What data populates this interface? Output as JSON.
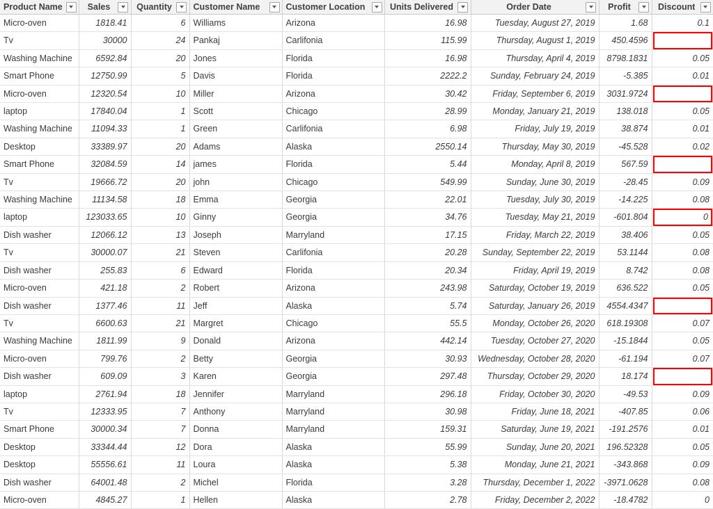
{
  "table": {
    "columns": [
      {
        "key": "product_name",
        "label": "Product Name",
        "align": "left",
        "header_align": "left",
        "filter": true
      },
      {
        "key": "sales",
        "label": "Sales",
        "align": "right",
        "header_align": "center",
        "filter": true
      },
      {
        "key": "quantity",
        "label": "Quantity",
        "align": "right",
        "header_align": "center",
        "filter": true
      },
      {
        "key": "customer_name",
        "label": "Customer Name",
        "align": "left",
        "header_align": "left",
        "filter": true
      },
      {
        "key": "customer_location",
        "label": "Customer Location",
        "align": "left",
        "header_align": "left",
        "filter": true
      },
      {
        "key": "units_delivered",
        "label": "Units Delivered",
        "align": "right",
        "header_align": "center",
        "filter": true
      },
      {
        "key": "order_date",
        "label": "Order Date",
        "align": "right",
        "header_align": "center",
        "filter": true
      },
      {
        "key": "profit",
        "label": "Profit",
        "align": "right",
        "header_align": "center",
        "filter": true
      },
      {
        "key": "discount",
        "label": "Discount",
        "align": "right",
        "header_align": "center",
        "filter": true
      }
    ],
    "filter_icon": "filter-dropdown-icon",
    "highlight_color": "#ff0000",
    "header_background": "#f2f2f2",
    "rows": [
      {
        "product_name": "Micro-oven",
        "sales": "1818.41",
        "quantity": "6",
        "customer_name": "Williams",
        "customer_location": "Arizona",
        "units_delivered": "16.98",
        "order_date": "Tuesday, August 27, 2019",
        "profit": "1.68",
        "discount": "0.1",
        "discount_highlighted": false
      },
      {
        "product_name": "Tv",
        "sales": "30000",
        "quantity": "24",
        "customer_name": "Pankaj",
        "customer_location": "Carlifonia",
        "units_delivered": "115.99",
        "order_date": "Thursday, August 1, 2019",
        "profit": "450.4596",
        "discount": "",
        "discount_highlighted": true
      },
      {
        "product_name": "Washing Machine",
        "sales": "6592.84",
        "quantity": "20",
        "customer_name": "Jones",
        "customer_location": "Florida",
        "units_delivered": "16.98",
        "order_date": "Thursday, April 4, 2019",
        "profit": "8798.1831",
        "discount": "0.05",
        "discount_highlighted": false
      },
      {
        "product_name": "Smart Phone",
        "sales": "12750.99",
        "quantity": "5",
        "customer_name": "Davis",
        "customer_location": "Florida",
        "units_delivered": "2222.2",
        "order_date": "Sunday, February 24, 2019",
        "profit": "-5.385",
        "discount": "0.01",
        "discount_highlighted": false
      },
      {
        "product_name": "Micro-oven",
        "sales": "12320.54",
        "quantity": "10",
        "customer_name": "Miller",
        "customer_location": "Arizona",
        "units_delivered": "30.42",
        "order_date": "Friday, September 6, 2019",
        "profit": "3031.9724",
        "discount": "",
        "discount_highlighted": true
      },
      {
        "product_name": "laptop",
        "sales": "17840.04",
        "quantity": "1",
        "customer_name": "Scott",
        "customer_location": "Chicago",
        "units_delivered": "28.99",
        "order_date": "Monday, January 21, 2019",
        "profit": "138.018",
        "discount": "0.05",
        "discount_highlighted": false
      },
      {
        "product_name": "Washing Machine",
        "sales": "11094.33",
        "quantity": "1",
        "customer_name": "Green",
        "customer_location": "Carlifonia",
        "units_delivered": "6.98",
        "order_date": "Friday, July 19, 2019",
        "profit": "38.874",
        "discount": "0.01",
        "discount_highlighted": false
      },
      {
        "product_name": "Desktop",
        "sales": "33389.97",
        "quantity": "20",
        "customer_name": "Adams",
        "customer_location": "Alaska",
        "units_delivered": "2550.14",
        "order_date": "Thursday, May 30, 2019",
        "profit": "-45.528",
        "discount": "0.02",
        "discount_highlighted": false
      },
      {
        "product_name": "Smart Phone",
        "sales": "32084.59",
        "quantity": "14",
        "customer_name": "james",
        "customer_location": "Florida",
        "units_delivered": "5.44",
        "order_date": "Monday, April 8, 2019",
        "profit": "567.59",
        "discount": "",
        "discount_highlighted": true
      },
      {
        "product_name": "Tv",
        "sales": "19666.72",
        "quantity": "20",
        "customer_name": "john",
        "customer_location": "Chicago",
        "units_delivered": "549.99",
        "order_date": "Sunday, June 30, 2019",
        "profit": "-28.45",
        "discount": "0.09",
        "discount_highlighted": false
      },
      {
        "product_name": "Washing Machine",
        "sales": "11134.58",
        "quantity": "18",
        "customer_name": "Emma",
        "customer_location": "Georgia",
        "units_delivered": "22.01",
        "order_date": "Tuesday, July 30, 2019",
        "profit": "-14.225",
        "discount": "0.08",
        "discount_highlighted": false
      },
      {
        "product_name": "laptop",
        "sales": "123033.65",
        "quantity": "10",
        "customer_name": "Ginny",
        "customer_location": "Georgia",
        "units_delivered": "34.76",
        "order_date": "Tuesday, May 21, 2019",
        "profit": "-601.804",
        "discount": "0",
        "discount_highlighted": true
      },
      {
        "product_name": "Dish washer",
        "sales": "12066.12",
        "quantity": "13",
        "customer_name": "Joseph",
        "customer_location": "Marryland",
        "units_delivered": "17.15",
        "order_date": "Friday, March 22, 2019",
        "profit": "38.406",
        "discount": "0.05",
        "discount_highlighted": false
      },
      {
        "product_name": "Tv",
        "sales": "30000.07",
        "quantity": "21",
        "customer_name": "Steven",
        "customer_location": "Carlifonia",
        "units_delivered": "20.28",
        "order_date": "Sunday, September 22, 2019",
        "profit": "53.1144",
        "discount": "0.08",
        "discount_highlighted": false
      },
      {
        "product_name": "Dish washer",
        "sales": "255.83",
        "quantity": "6",
        "customer_name": "Edward",
        "customer_location": "Florida",
        "units_delivered": "20.34",
        "order_date": "Friday, April 19, 2019",
        "profit": "8.742",
        "discount": "0.08",
        "discount_highlighted": false
      },
      {
        "product_name": "Micro-oven",
        "sales": "421.18",
        "quantity": "2",
        "customer_name": "Robert",
        "customer_location": "Arizona",
        "units_delivered": "243.98",
        "order_date": "Saturday, October 19, 2019",
        "profit": "636.522",
        "discount": "0.05",
        "discount_highlighted": false
      },
      {
        "product_name": "Dish washer",
        "sales": "1377.46",
        "quantity": "11",
        "customer_name": "Jeff",
        "customer_location": "Alaska",
        "units_delivered": "5.74",
        "order_date": "Saturday, January 26, 2019",
        "profit": "4554.4347",
        "discount": "",
        "discount_highlighted": true
      },
      {
        "product_name": "Tv",
        "sales": "6600.63",
        "quantity": "21",
        "customer_name": "Margret",
        "customer_location": "Chicago",
        "units_delivered": "55.5",
        "order_date": "Monday, October 26, 2020",
        "profit": "618.19308",
        "discount": "0.07",
        "discount_highlighted": false
      },
      {
        "product_name": "Washing Machine",
        "sales": "1811.99",
        "quantity": "9",
        "customer_name": "Donald",
        "customer_location": "Arizona",
        "units_delivered": "442.14",
        "order_date": "Tuesday, October 27, 2020",
        "profit": "-15.1844",
        "discount": "0.05",
        "discount_highlighted": false
      },
      {
        "product_name": "Micro-oven",
        "sales": "799.76",
        "quantity": "2",
        "customer_name": "Betty",
        "customer_location": "Georgia",
        "units_delivered": "30.93",
        "order_date": "Wednesday, October 28, 2020",
        "profit": "-61.194",
        "discount": "0.07",
        "discount_highlighted": false
      },
      {
        "product_name": "Dish washer",
        "sales": "609.09",
        "quantity": "3",
        "customer_name": "Karen",
        "customer_location": "Georgia",
        "units_delivered": "297.48",
        "order_date": "Thursday, October 29, 2020",
        "profit": "18.174",
        "discount": "",
        "discount_highlighted": true
      },
      {
        "product_name": "laptop",
        "sales": "2761.94",
        "quantity": "18",
        "customer_name": "Jennifer",
        "customer_location": "Marryland",
        "units_delivered": "296.18",
        "order_date": "Friday, October 30, 2020",
        "profit": "-49.53",
        "discount": "0.09",
        "discount_highlighted": false
      },
      {
        "product_name": "Tv",
        "sales": "12333.95",
        "quantity": "7",
        "customer_name": "Anthony",
        "customer_location": "Marryland",
        "units_delivered": "30.98",
        "order_date": "Friday, June 18, 2021",
        "profit": "-407.85",
        "discount": "0.06",
        "discount_highlighted": false
      },
      {
        "product_name": "Smart Phone",
        "sales": "30000.34",
        "quantity": "7",
        "customer_name": "Donna",
        "customer_location": "Marryland",
        "units_delivered": "159.31",
        "order_date": "Saturday, June 19, 2021",
        "profit": "-191.2576",
        "discount": "0.01",
        "discount_highlighted": false
      },
      {
        "product_name": "Desktop",
        "sales": "33344.44",
        "quantity": "12",
        "customer_name": "Dora",
        "customer_location": "Alaska",
        "units_delivered": "55.99",
        "order_date": "Sunday, June 20, 2021",
        "profit": "196.52328",
        "discount": "0.05",
        "discount_highlighted": false
      },
      {
        "product_name": "Desktop",
        "sales": "55556.61",
        "quantity": "11",
        "customer_name": "Loura",
        "customer_location": "Alaska",
        "units_delivered": "5.38",
        "order_date": "Monday, June 21, 2021",
        "profit": "-343.868",
        "discount": "0.09",
        "discount_highlighted": false
      },
      {
        "product_name": "Dish washer",
        "sales": "64001.48",
        "quantity": "2",
        "customer_name": "Michel",
        "customer_location": "Florida",
        "units_delivered": "3.28",
        "order_date": "Thursday, December 1, 2022",
        "profit": "-3971.0628",
        "discount": "0.08",
        "discount_highlighted": false
      },
      {
        "product_name": "Micro-oven",
        "sales": "4845.27",
        "quantity": "1",
        "customer_name": "Hellen",
        "customer_location": "Alaska",
        "units_delivered": "2.78",
        "order_date": "Friday, December 2, 2022",
        "profit": "-18.4782",
        "discount": "0",
        "discount_highlighted": false
      }
    ]
  }
}
